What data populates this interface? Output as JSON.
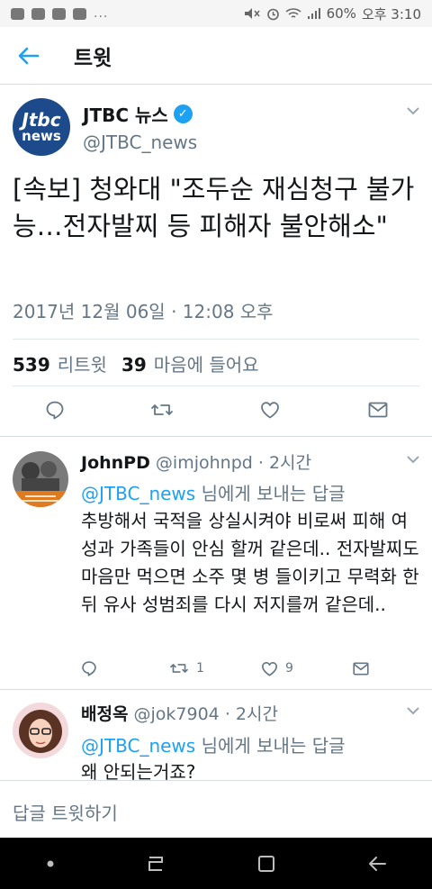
{
  "status_bar": {
    "battery": "60%",
    "time": "오후 3:10",
    "icons": [
      "line-icon",
      "youtube-icon",
      "gallery-icon",
      "kakaotalk-icon",
      "more-dots"
    ]
  },
  "header": {
    "title": "트윗"
  },
  "tweet": {
    "author_name": "JTBC 뉴스",
    "author_handle": "@JTBC_news",
    "avatar_text_top": "Jtbc",
    "avatar_text_bottom": "news",
    "text": "[속보] 청와대 \"조두순 재심청구 불가능…전자발찌 등 피해자 불안해소\"",
    "datetime": "2017년 12월 06일 · 12:08 오후",
    "retweet_count": "539",
    "retweet_label": "리트윗",
    "like_count": "39",
    "like_label": "마음에 들어요"
  },
  "replies": [
    {
      "name": "JohnPD",
      "handle": "@imjohnpd",
      "time": "· 2시간",
      "reply_to_mention": "@JTBC_news",
      "reply_to_suffix": " 님에게 보내는 답글",
      "text": "추방해서 국적을 상실시켜야 비로써 피해 여성과 가족들이 안심 할꺼 같은데.. 전자발찌도 마음만 먹으면 소주 몇 병 들이키고 무력화 한뒤 유사 성범죄를 다시 저지를꺼 같은데..",
      "retweets": "1",
      "likes": "9"
    },
    {
      "name": "배정옥",
      "handle": "@jok7904",
      "time": "· 2시간",
      "reply_to_mention": "@JTBC_news",
      "reply_to_suffix": " 님에게 보내는 답글",
      "text": "왜 안되는거죠?"
    }
  ],
  "compose": {
    "placeholder": "답글 트윗하기"
  },
  "colors": {
    "accent": "#1da1f2",
    "muted": "#657786",
    "text": "#14171a",
    "jtbc_blue": "#1c4a8a"
  }
}
